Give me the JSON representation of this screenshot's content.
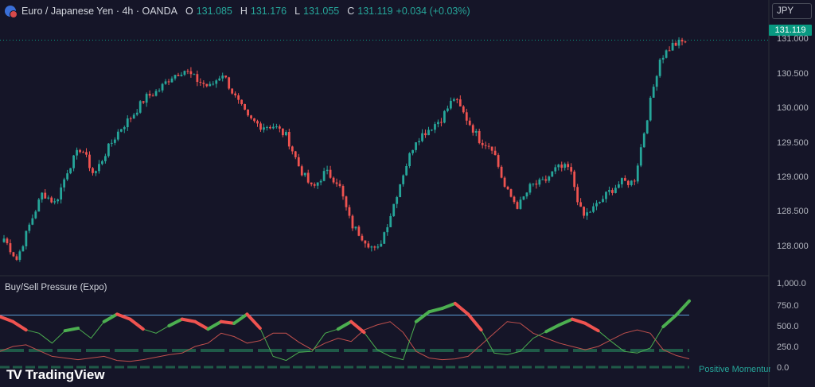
{
  "header": {
    "title": "Euro / Japanese Yen · 4h · OANDA",
    "o_label": "O",
    "o_value": "131.085",
    "h_label": "H",
    "h_value": "131.176",
    "l_label": "L",
    "l_value": "131.055",
    "c_label": "C",
    "c_value": "131.119",
    "change": "+0.034 (+0.03%)"
  },
  "currency_button": "JPY",
  "last_price_tag": "131.119",
  "price_axis": [
    "131.000",
    "130.500",
    "130.000",
    "129.500",
    "129.000",
    "128.500",
    "128.000"
  ],
  "indicator": {
    "title": "Buy/Sell Pressure (Expo)",
    "axis": [
      "1,000.0",
      "750.0",
      "500.0",
      "250.0",
      "0.0"
    ],
    "legend": "Positive Momentum"
  },
  "branding": {
    "logo_text": "TradingView"
  },
  "colors": {
    "background": "#151528",
    "up": "#26a69a",
    "down": "#ef5350",
    "last_price": "#089981",
    "pressure_buy": "#4caf50",
    "pressure_sell": "#ef5350",
    "level_line": "#5b9bd5"
  },
  "chart_data": {
    "type": "candlestick",
    "symbol": "EUR/JPY",
    "timeframe": "4h",
    "ylim": [
      127.85,
      131.35
    ],
    "last": 131.119,
    "close_path": [
      128.3,
      128.0,
      128.5,
      128.95,
      128.8,
      129.3,
      129.6,
      129.2,
      129.55,
      129.85,
      130.05,
      130.3,
      130.4,
      130.6,
      130.7,
      130.55,
      130.45,
      130.65,
      130.3,
      130.0,
      129.9,
      129.9,
      129.75,
      129.3,
      129.0,
      129.25,
      129.1,
      128.5,
      128.3,
      128.1,
      128.6,
      129.2,
      129.7,
      129.85,
      130.0,
      130.3,
      130.0,
      129.7,
      129.6,
      129.0,
      128.75,
      129.05,
      129.1,
      129.3,
      129.3,
      128.6,
      128.75,
      128.95,
      129.1,
      129.1,
      130.0,
      130.85,
      131.05,
      131.1
    ],
    "pressure": {
      "level": 640,
      "buy_line": [
        620,
        560,
        460,
        420,
        300,
        450,
        480,
        360,
        560,
        650,
        590,
        470,
        420,
        510,
        590,
        560,
        470,
        560,
        540,
        650,
        480,
        140,
        90,
        190,
        200,
        420,
        470,
        560,
        430,
        220,
        140,
        100,
        560,
        680,
        720,
        780,
        650,
        460,
        180,
        160,
        200,
        360,
        440,
        520,
        590,
        540,
        450,
        320,
        200,
        180,
        240,
        500,
        640,
        810
      ],
      "sell_line": [
        200,
        260,
        280,
        210,
        140,
        120,
        100,
        120,
        140,
        90,
        80,
        100,
        130,
        160,
        180,
        260,
        300,
        420,
        380,
        300,
        330,
        420,
        420,
        310,
        220,
        300,
        360,
        320,
        460,
        520,
        560,
        430,
        200,
        120,
        100,
        110,
        140,
        280,
        420,
        560,
        540,
        420,
        360,
        300,
        260,
        220,
        260,
        340,
        420,
        460,
        420,
        220,
        150,
        110
      ]
    }
  }
}
